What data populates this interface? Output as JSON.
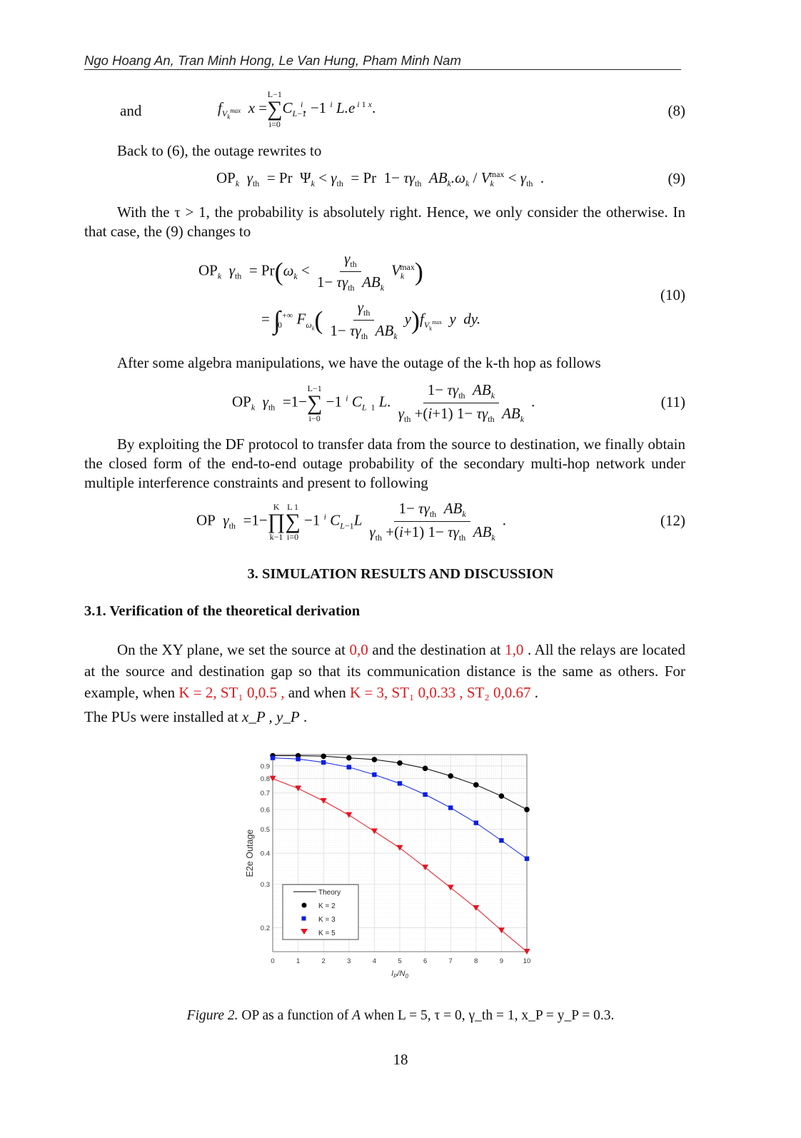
{
  "header": {
    "authors": "Ngo Hoang An, Tran Minh Hong, Le Van Hung, Pham Minh Nam"
  },
  "eq8": {
    "lead": "and",
    "lhs": "f",
    "sub": "V_k^max",
    "arg": "x",
    "body": "= Σ_{i=0}^{L−1} C^i_{L−1}. −1^i L.e^{i+1 x}.",
    "number": "(8)"
  },
  "p_back": "Back to (6), the outage rewrites to",
  "eq9": {
    "body": "OP_k γ_th = Pr Ψ_k < γ_th = Pr 1−τγ_th AB_k.ω_k / V_k^max < γ_th .",
    "number": "(9)"
  },
  "p_with": "With the τ > 1, the probability is absolutely right. Hence, we only consider the otherwise. In that case, the (9) changes to",
  "eq10": {
    "line1": "OP_k γ_th = Pr( ω_k < γ_th / (1−τγ_th AB_k) V_k^max )",
    "line2": "= ∫_0^{+∞} F_{ω_k}( γ_th / (1−τγ_th AB_k) y ) f_{V_k^max} y dy.",
    "number": "(10)"
  },
  "p_after": "After some algebra manipulations, we have the outage of the k-th hop as follows",
  "eq11": {
    "body": "OP_k γ_th = 1 − Σ_{i−0}^{L−1} −1^i C^i_{L 1} L. (1−τγ_th AB_k) / (γ_th + (i+1) 1−τγ_th AB_k).",
    "number": "(11)"
  },
  "p_by": "By exploiting the DF protocol to transfer data from the source to destination, we finally obtain the closed form of the end-to-end outage probability of the secondary multi-hop network under multiple interference constraints and present to following",
  "eq12": {
    "body": "OP γ_th = 1 − Π_{k−1}^{K} Σ_{i=0}^{L 1} −1^i C^i_{L−1} L (1−τγ_th AB_k) / (γ_th + (i+1) 1−τγ_th AB_k).",
    "number": "(12)"
  },
  "section": "3.   SIMULATION RESULTS AND DISCUSSION",
  "subsection": "3.1. Verification of the theoretical derivation",
  "p_xy": {
    "t1": "On the XY plane, we set the source at",
    "src": "0,0",
    "t2": "and the destination at",
    "dst": "1,0",
    "t3": ". All the relays are located at the source and destination gap so that its communication distance is the same as others. For example, when",
    "ex1": "K = 2,  ST₁  0,0.5  ,",
    "t4": "and  when",
    "ex2": "K = 3, ST₁  0,0.33  , ST₂  0,0.67",
    "t5": ".",
    "t6": "The PUs were installed at",
    "pu": "x_P , y_P",
    "t7": "."
  },
  "caption": {
    "label": "Figure 2.",
    "text": "OP as a function of",
    "var": "A",
    "cond": "when  L = 5,  τ = 0,  γ_th = 1,  x_P = y_P = 0.3."
  },
  "page_number": "18",
  "colors": {
    "k2": "#000000",
    "k3": "#0a1ee6",
    "k5": "#e6141e",
    "highlight": "#e0191c"
  },
  "chart_data": {
    "type": "line",
    "title": "",
    "xlabel": "I_P/N_0",
    "ylabel": "E2e Outage",
    "x": [
      0,
      1,
      2,
      3,
      4,
      5,
      6,
      7,
      8,
      9,
      10
    ],
    "xlim": [
      0,
      10
    ],
    "ylim": [
      0.16,
      1.0
    ],
    "yscale": "log",
    "xticks": [
      "0",
      "1",
      "2",
      "3",
      "4",
      "5",
      "6",
      "7",
      "8",
      "9",
      "10"
    ],
    "yticks": [
      0.2,
      0.3,
      0.4,
      0.5,
      0.6,
      0.7,
      0.8,
      0.9
    ],
    "ytick_labels": [
      "0.2",
      "0.3",
      "0.4",
      "0.5",
      "0.6",
      "0.7",
      "0.8",
      "0.9"
    ],
    "grid": true,
    "legend_position": "bottom-left",
    "legend": [
      {
        "label": "Theory",
        "marker": "line"
      },
      {
        "label": "K = 2",
        "marker": "circle"
      },
      {
        "label": "K = 3",
        "marker": "square"
      },
      {
        "label": "K = 5",
        "marker": "triangle-down"
      }
    ],
    "series": [
      {
        "name": "K = 2",
        "marker": "circle",
        "values": [
          0.99,
          0.99,
          0.985,
          0.97,
          0.955,
          0.925,
          0.88,
          0.82,
          0.755,
          0.68,
          0.6
        ]
      },
      {
        "name": "K = 3",
        "marker": "square",
        "values": [
          0.97,
          0.96,
          0.93,
          0.89,
          0.83,
          0.765,
          0.69,
          0.61,
          0.53,
          0.45,
          0.38
        ]
      },
      {
        "name": "K = 5",
        "marker": "triangle-down",
        "values": [
          0.8,
          0.73,
          0.65,
          0.57,
          0.49,
          0.42,
          0.35,
          0.29,
          0.24,
          0.195,
          0.16
        ]
      }
    ]
  }
}
